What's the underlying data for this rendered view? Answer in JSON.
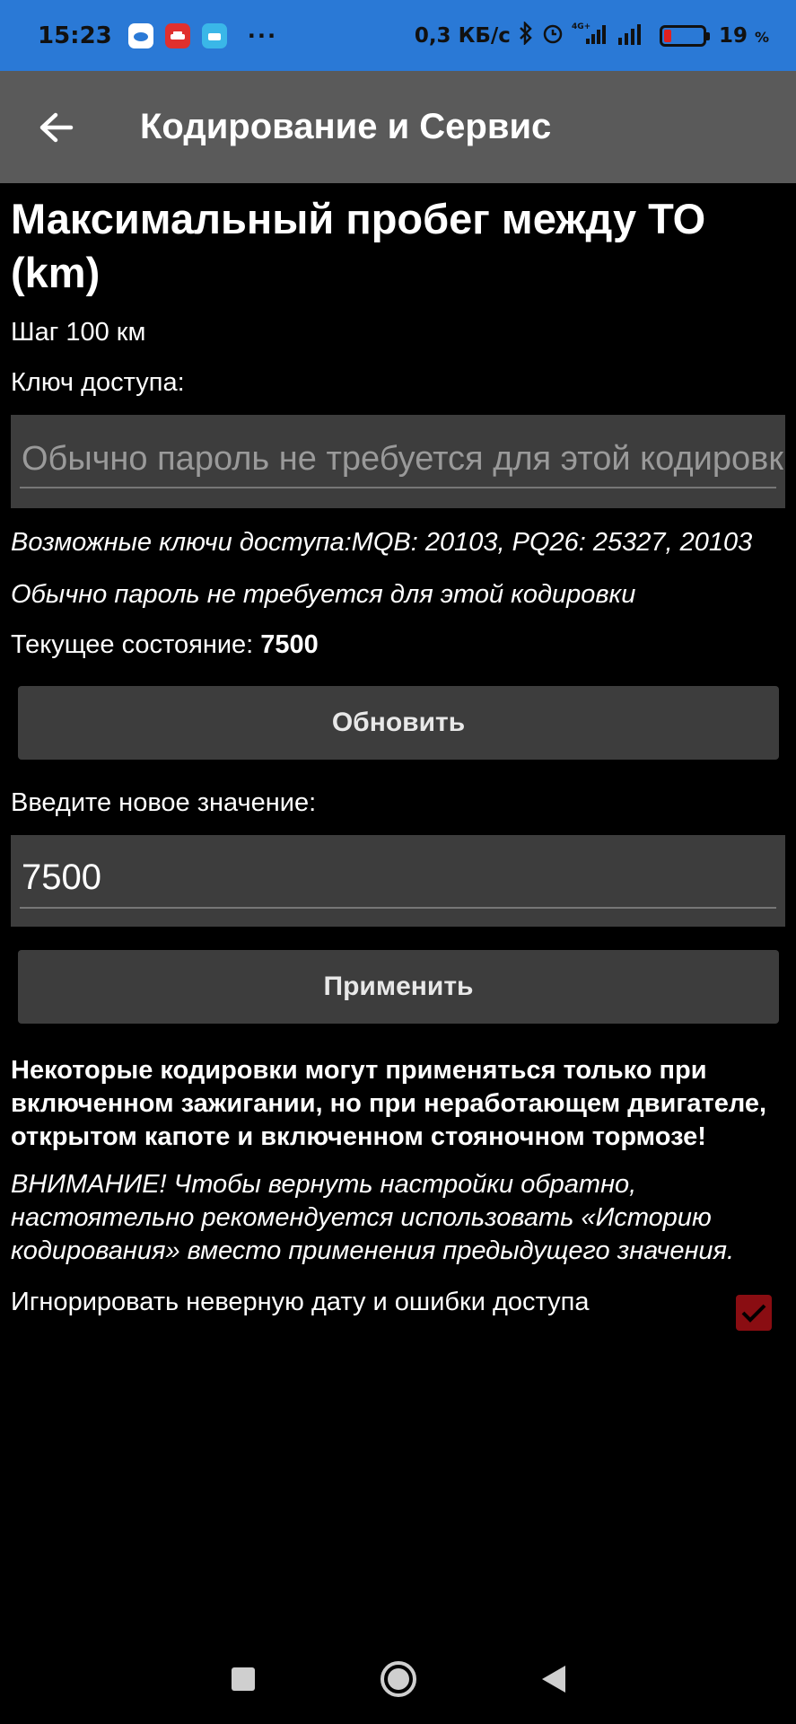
{
  "status_bar": {
    "time": "15:23",
    "more": "···",
    "network_speed": "0,3 КБ/с",
    "network_type": "4G+",
    "battery_percent": "19",
    "battery_unit": "%",
    "battery_level": 0.19,
    "colors": {
      "background": "#2a79d6",
      "battery_low": "#e02020"
    }
  },
  "app_bar": {
    "title": "Кодирование и Сервис",
    "back_icon": "arrow-left-icon"
  },
  "main": {
    "heading": "Максимальный пробег между ТО (km)",
    "step": "Шаг 100 км",
    "key_label": "Ключ доступа:",
    "key_placeholder": "Обычно пароль не требуется для этой кодировки",
    "possible_keys": "Возможные ключи доступа:MQB: 20103, PQ26: 25327, 20103",
    "hint": "Обычно пароль не требуется для этой кодировки",
    "current_state_label": "Текущее состояние:",
    "current_state_value": "7500",
    "refresh_button": "Обновить",
    "new_value_label": "Введите новое значение:",
    "new_value": "7500",
    "apply_button": "Применить",
    "warning_bold": "Некоторые кодировки могут применяться только при включенном зажигании, но при неработающем двигателе, открытом капоте и включенном стояночном тормозе!",
    "warning_italic": "ВНИМАНИЕ! Чтобы вернуть настройки обратно, настоятельно рекомендуется использовать «Историю кодирования» вместо применения предыдущего значения.",
    "ignore_checkbox_label": "Игнорировать неверную дату и ошибки доступа",
    "ignore_checkbox_checked": true,
    "colors": {
      "field_bg": "#3d3d3d",
      "button_bg": "#3d3d3d",
      "checkbox": "#8a0d12"
    }
  },
  "nav_bar": {
    "recents_icon": "square-icon",
    "home_icon": "circle-icon",
    "back_icon": "triangle-back-icon"
  }
}
